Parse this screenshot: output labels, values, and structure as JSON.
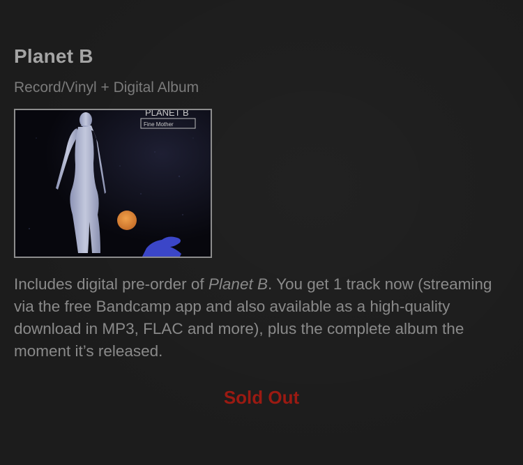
{
  "product": {
    "title": "Planet B",
    "format": "Record/Vinyl + Digital Album",
    "cover": {
      "corner_text_line1": "PLANET B",
      "corner_text_line2": "Fine Mother"
    },
    "description": {
      "part1": "Includes digital pre-order of ",
      "album_name": "Planet B",
      "part2": ". You get 1 track now (streaming via the free Bandcamp app and also available as a high-quality download in MP3, FLAC and more), plus the complete album the moment it’s released."
    },
    "status": "Sold Out"
  },
  "colors": {
    "background": "#1c1c1c",
    "title": "#a4a4a4",
    "secondary_text": "#7b7b7b",
    "body_text": "#8a8a8a",
    "sold_out": "#9b1a12"
  }
}
